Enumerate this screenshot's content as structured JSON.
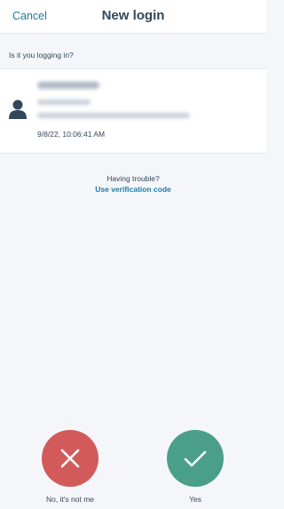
{
  "header": {
    "cancel_label": "Cancel",
    "title": "New login"
  },
  "prompt": {
    "question": "Is it you logging in?"
  },
  "login": {
    "timestamp": "9/8/22, 10:06:41 AM"
  },
  "help": {
    "trouble_text": "Having trouble?",
    "verification_link": "Use verification code"
  },
  "actions": {
    "no_label": "No, it's not me",
    "yes_label": "Yes"
  },
  "colors": {
    "accent": "#1f7aa3",
    "deny": "#d25a5a",
    "approve": "#4a9f8a"
  },
  "icons": {
    "avatar": "person-icon",
    "deny": "close-icon",
    "approve": "checkmark-icon"
  }
}
